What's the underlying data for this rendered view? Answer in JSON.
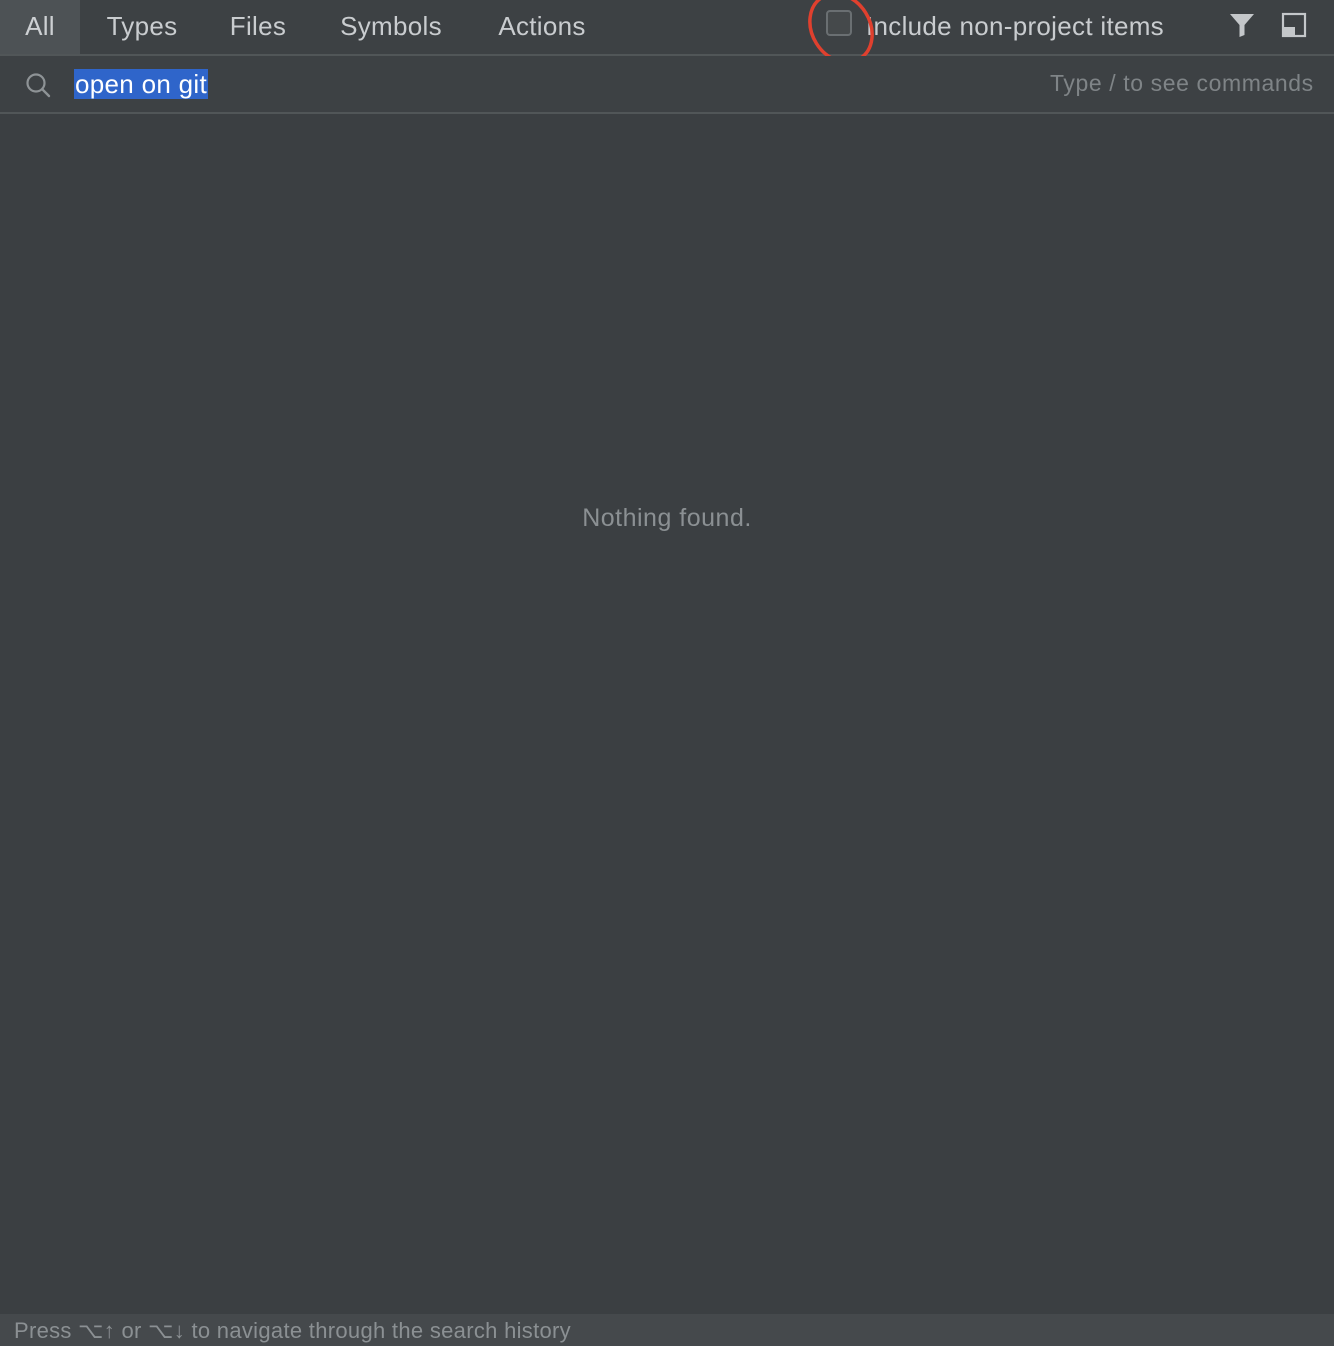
{
  "tabs": [
    {
      "label": "All",
      "active": true
    },
    {
      "label": "Types",
      "active": false
    },
    {
      "label": "Files",
      "active": false
    },
    {
      "label": "Symbols",
      "active": false
    },
    {
      "label": "Actions",
      "active": false
    }
  ],
  "options": {
    "include_non_project_label": "Include non-project items",
    "include_non_project_checked": false
  },
  "icons": {
    "filter": "filter-icon",
    "preview": "preview-panel-icon",
    "search": "search-icon"
  },
  "search": {
    "query": "open on git",
    "hint": "Type / to see commands"
  },
  "results": {
    "empty_message": "Nothing found."
  },
  "footer": {
    "hint": "Press ⌥↑ or ⌥↓ to navigate through the search history"
  },
  "colors": {
    "background": "#3b3f42",
    "selection": "#2f65ca",
    "annotation": "#e0402e"
  }
}
